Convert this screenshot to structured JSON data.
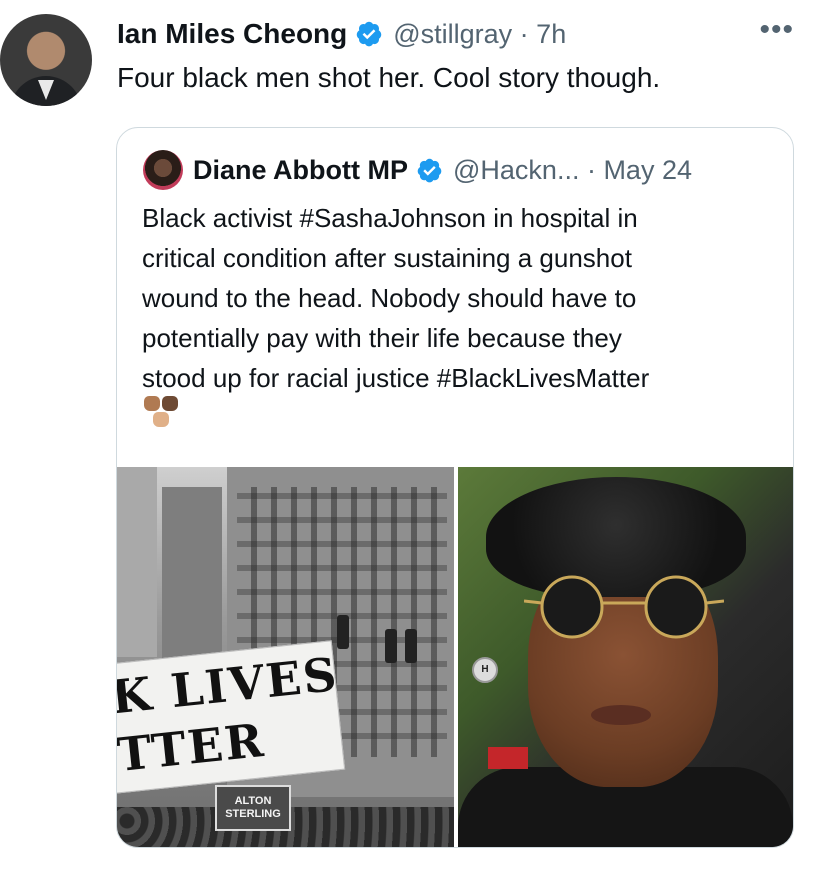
{
  "tweet": {
    "author_name": "Ian Miles Cheong",
    "handle_time": "@stillgray · 7h",
    "more_label": "•••",
    "text": "Four black men shot her. Cool story though."
  },
  "quoted_tweet": {
    "author_name": "Diane Abbott MP",
    "handle_time": "@Hackn... · May 24",
    "text": "Black activist #SashaJohnson in hospital in\ncritical condition after sustaining a gunshot\nwound to the head. Nobody should have to\npotentially pay with their life because they\nstood up for racial justice #BlackLivesMatter",
    "media": {
      "banner_line_1": "K LIVES",
      "banner_line_2": "TTER",
      "sign_line_1": "ALTON",
      "sign_line_2": "STERLING",
      "badge_text": "H"
    }
  },
  "colors": {
    "verified_blue": "#1d9bf0",
    "text_primary": "#0f1419",
    "text_secondary": "#536471",
    "border": "#cfd9de"
  }
}
